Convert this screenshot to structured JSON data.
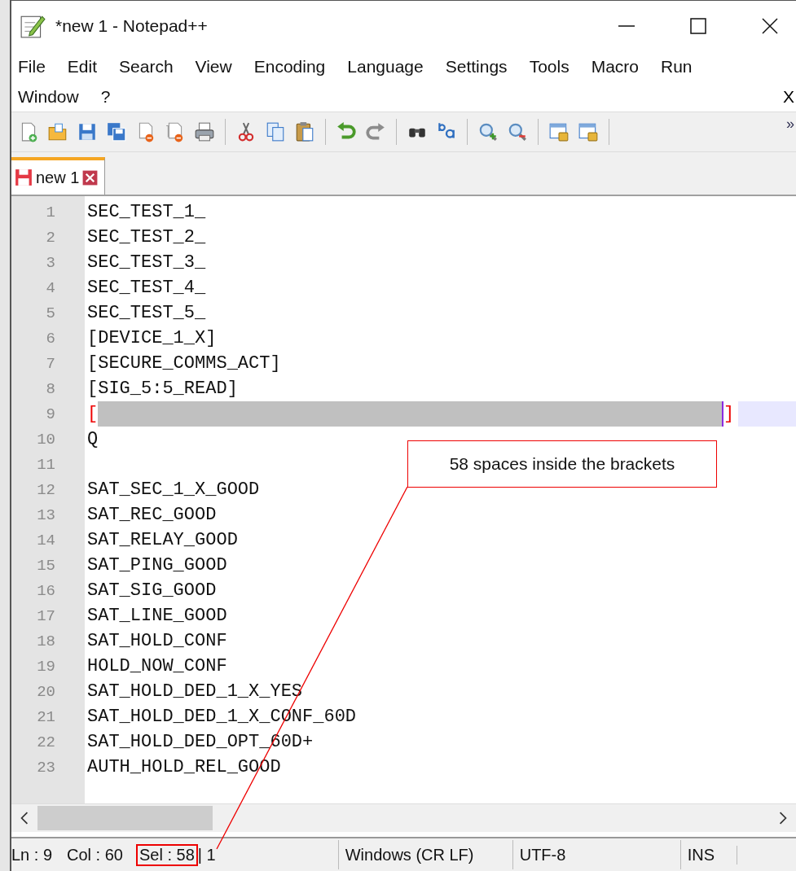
{
  "window": {
    "title": "*new 1 - Notepad++"
  },
  "menu": {
    "rows": [
      [
        "File",
        "Edit",
        "Search",
        "View",
        "Encoding",
        "Language",
        "Settings",
        "Tools",
        "Macro",
        "Run"
      ],
      [
        "Window",
        "?"
      ]
    ],
    "close": "X"
  },
  "toolbar": {
    "overflow": "»"
  },
  "tabs": [
    {
      "label": "new 1",
      "selected": true,
      "modified": true
    }
  ],
  "editor": {
    "lines": [
      {
        "number": "1",
        "kind": "text",
        "text": "SEC_TEST_1_"
      },
      {
        "number": "2",
        "kind": "text",
        "text": "SEC_TEST_2_"
      },
      {
        "number": "3",
        "kind": "text",
        "text": "SEC_TEST_3_"
      },
      {
        "number": "4",
        "kind": "text",
        "text": "SEC_TEST_4_"
      },
      {
        "number": "5",
        "kind": "text",
        "text": "SEC_TEST_5_"
      },
      {
        "number": "6",
        "kind": "text",
        "text": "[DEVICE_1_X]"
      },
      {
        "number": "7",
        "kind": "text",
        "text": "[SECURE_COMMS_ACT]"
      },
      {
        "number": "8",
        "kind": "text",
        "text": "[SIG_5:5_READ]"
      },
      {
        "number": "9",
        "kind": "selection",
        "open": "[",
        "close": "]"
      },
      {
        "number": "10",
        "kind": "text",
        "text": "Q"
      },
      {
        "number": "11",
        "kind": "text"
      },
      {
        "number": "12",
        "kind": "text",
        "text": "SAT_SEC_1_X_GOOD"
      },
      {
        "number": "13",
        "kind": "text",
        "text": "SAT_REC_GOOD"
      },
      {
        "number": "14",
        "kind": "text",
        "text": "SAT_RELAY_GOOD"
      },
      {
        "number": "15",
        "kind": "text",
        "text": "SAT_PING_GOOD"
      },
      {
        "number": "16",
        "kind": "text",
        "text": "SAT_SIG_GOOD"
      },
      {
        "number": "17",
        "kind": "text",
        "text": "SAT_LINE_GOOD"
      },
      {
        "number": "18",
        "kind": "text",
        "text": "SAT_HOLD_CONF"
      },
      {
        "number": "19",
        "kind": "text",
        "text": "HOLD_NOW_CONF"
      },
      {
        "number": "20",
        "kind": "text",
        "text": "SAT_HOLD_DED_1_X_YES"
      },
      {
        "number": "21",
        "kind": "text",
        "text": "SAT_HOLD_DED_1_X_CONF_60D"
      },
      {
        "number": "22",
        "kind": "text",
        "text": "SAT_HOLD_DED_OPT_60D+"
      },
      {
        "number": "23",
        "kind": "text",
        "text": "AUTH_HOLD_REL_GOOD"
      }
    ]
  },
  "status_bar": [
    {
      "kind": "plain",
      "text": "Ln : 9"
    },
    {
      "kind": "plain",
      "text": "Col : 60"
    },
    {
      "kind": "highlighted",
      "text": "Sel : 58"
    },
    {
      "kind": "plain",
      "text": "| 1"
    },
    {
      "kind": "panel",
      "text": "Windows (CR LF)"
    },
    {
      "kind": "panel",
      "text": "UTF-8"
    },
    {
      "kind": "panel",
      "text": "INS"
    }
  ],
  "annotation": {
    "text": "58 spaces inside the brackets"
  }
}
